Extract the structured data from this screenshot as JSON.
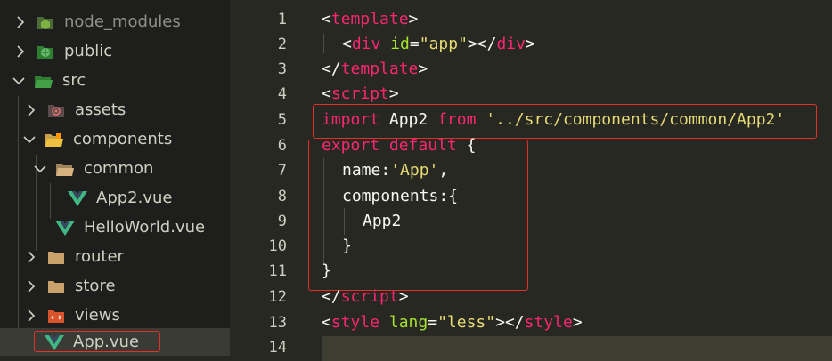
{
  "explorer": {
    "items": [
      {
        "label": "node_modules",
        "icon": "nodejs-folder-icon",
        "expanded": false
      },
      {
        "label": "public",
        "icon": "public-folder-icon",
        "expanded": false
      },
      {
        "label": "src",
        "icon": "src-folder-icon",
        "expanded": true
      },
      {
        "label": "assets",
        "icon": "assets-folder-icon",
        "expanded": false
      },
      {
        "label": "components",
        "icon": "components-folder-icon",
        "expanded": true
      },
      {
        "label": "common",
        "icon": "folder-open-icon",
        "expanded": true
      },
      {
        "label": "App2.vue",
        "icon": "vue-file-icon"
      },
      {
        "label": "HelloWorld.vue",
        "icon": "vue-file-icon"
      },
      {
        "label": "router",
        "icon": "folder-icon",
        "expanded": false
      },
      {
        "label": "store",
        "icon": "folder-icon",
        "expanded": false
      },
      {
        "label": "views",
        "icon": "views-folder-icon",
        "expanded": false
      },
      {
        "label": "App.vue",
        "icon": "vue-file-icon",
        "active": true
      }
    ]
  },
  "editor": {
    "line_numbers": [
      "1",
      "2",
      "3",
      "4",
      "5",
      "6",
      "7",
      "8",
      "9",
      "10",
      "11",
      "12",
      "13",
      "14"
    ],
    "lines": {
      "l1": {
        "open": "<",
        "tag": "template",
        "close": ">"
      },
      "l2": {
        "open": "<",
        "tag": "div",
        "attr": "id",
        "eq": "=",
        "val": "\"app\"",
        "mid": "></",
        "tag2": "div",
        "close": ">"
      },
      "l3": {
        "open": "</",
        "tag": "template",
        "close": ">"
      },
      "l4": {
        "open": "<",
        "tag": "script",
        "close": ">"
      },
      "l5": {
        "kw1": "import",
        "name": " App2 ",
        "kw2": "from",
        "sp": " ",
        "str": "'../src/components/common/App2'"
      },
      "l6": {
        "kw1": "export",
        "sp": " ",
        "kw2": "default",
        "rest": " {"
      },
      "l7": {
        "key": "name:",
        "str": "'App'",
        "rest": ","
      },
      "l8": {
        "key": "components:{"
      },
      "l9": {
        "name": "App2"
      },
      "l10": {
        "text": "}"
      },
      "l11": {
        "text": "}"
      },
      "l12": {
        "open": "</",
        "tag": "script",
        "close": ">"
      },
      "l13": {
        "open": "<",
        "tag": "style",
        "sp": " ",
        "attr": "lang",
        "eq": "=",
        "val": "\"less\"",
        "mid": "></",
        "tag2": "style",
        "close": ">"
      }
    }
  },
  "colors": {
    "editor_bg": "#272822",
    "sidebar_bg": "#1e1f1c",
    "keyword": "#f92672",
    "attribute": "#a6e22e",
    "string": "#e6db74",
    "highlight_border": "#e0312b",
    "vue_green": "#41b883"
  }
}
